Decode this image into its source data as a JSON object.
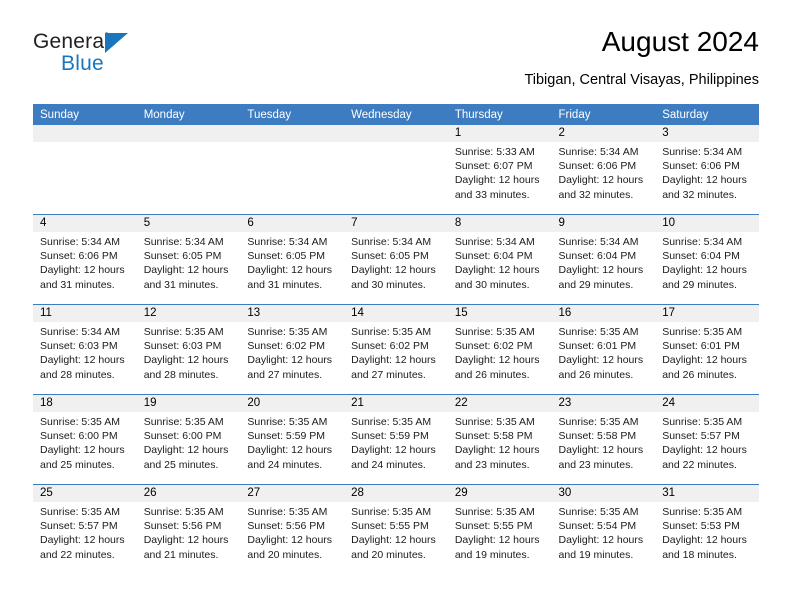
{
  "brand": {
    "name_top": "General",
    "name_bottom": "Blue",
    "triangle_color": "#1a76bc"
  },
  "header": {
    "title": "August 2024",
    "subtitle": "Tibigan, Central Visayas, Philippines",
    "accent_color": "#3d7cc0",
    "daynum_bg": "#f0f0f0"
  },
  "calendar": {
    "weekday_headers": [
      "Sunday",
      "Monday",
      "Tuesday",
      "Wednesday",
      "Thursday",
      "Friday",
      "Saturday"
    ],
    "labels": {
      "sunrise_prefix": "Sunrise:",
      "sunset_prefix": "Sunset:",
      "daylight_prefix": "Daylight:"
    },
    "weeks": [
      [
        {
          "day": "",
          "empty": true
        },
        {
          "day": "",
          "empty": true
        },
        {
          "day": "",
          "empty": true
        },
        {
          "day": "",
          "empty": true
        },
        {
          "day": "1",
          "sunrise": "Sunrise: 5:33 AM",
          "sunset": "Sunset: 6:07 PM",
          "daylight_line1": "Daylight: 12 hours",
          "daylight_line2": "and 33 minutes."
        },
        {
          "day": "2",
          "sunrise": "Sunrise: 5:34 AM",
          "sunset": "Sunset: 6:06 PM",
          "daylight_line1": "Daylight: 12 hours",
          "daylight_line2": "and 32 minutes."
        },
        {
          "day": "3",
          "sunrise": "Sunrise: 5:34 AM",
          "sunset": "Sunset: 6:06 PM",
          "daylight_line1": "Daylight: 12 hours",
          "daylight_line2": "and 32 minutes."
        }
      ],
      [
        {
          "day": "4",
          "sunrise": "Sunrise: 5:34 AM",
          "sunset": "Sunset: 6:06 PM",
          "daylight_line1": "Daylight: 12 hours",
          "daylight_line2": "and 31 minutes."
        },
        {
          "day": "5",
          "sunrise": "Sunrise: 5:34 AM",
          "sunset": "Sunset: 6:05 PM",
          "daylight_line1": "Daylight: 12 hours",
          "daylight_line2": "and 31 minutes."
        },
        {
          "day": "6",
          "sunrise": "Sunrise: 5:34 AM",
          "sunset": "Sunset: 6:05 PM",
          "daylight_line1": "Daylight: 12 hours",
          "daylight_line2": "and 31 minutes."
        },
        {
          "day": "7",
          "sunrise": "Sunrise: 5:34 AM",
          "sunset": "Sunset: 6:05 PM",
          "daylight_line1": "Daylight: 12 hours",
          "daylight_line2": "and 30 minutes."
        },
        {
          "day": "8",
          "sunrise": "Sunrise: 5:34 AM",
          "sunset": "Sunset: 6:04 PM",
          "daylight_line1": "Daylight: 12 hours",
          "daylight_line2": "and 30 minutes."
        },
        {
          "day": "9",
          "sunrise": "Sunrise: 5:34 AM",
          "sunset": "Sunset: 6:04 PM",
          "daylight_line1": "Daylight: 12 hours",
          "daylight_line2": "and 29 minutes."
        },
        {
          "day": "10",
          "sunrise": "Sunrise: 5:34 AM",
          "sunset": "Sunset: 6:04 PM",
          "daylight_line1": "Daylight: 12 hours",
          "daylight_line2": "and 29 minutes."
        }
      ],
      [
        {
          "day": "11",
          "sunrise": "Sunrise: 5:34 AM",
          "sunset": "Sunset: 6:03 PM",
          "daylight_line1": "Daylight: 12 hours",
          "daylight_line2": "and 28 minutes."
        },
        {
          "day": "12",
          "sunrise": "Sunrise: 5:35 AM",
          "sunset": "Sunset: 6:03 PM",
          "daylight_line1": "Daylight: 12 hours",
          "daylight_line2": "and 28 minutes."
        },
        {
          "day": "13",
          "sunrise": "Sunrise: 5:35 AM",
          "sunset": "Sunset: 6:02 PM",
          "daylight_line1": "Daylight: 12 hours",
          "daylight_line2": "and 27 minutes."
        },
        {
          "day": "14",
          "sunrise": "Sunrise: 5:35 AM",
          "sunset": "Sunset: 6:02 PM",
          "daylight_line1": "Daylight: 12 hours",
          "daylight_line2": "and 27 minutes."
        },
        {
          "day": "15",
          "sunrise": "Sunrise: 5:35 AM",
          "sunset": "Sunset: 6:02 PM",
          "daylight_line1": "Daylight: 12 hours",
          "daylight_line2": "and 26 minutes."
        },
        {
          "day": "16",
          "sunrise": "Sunrise: 5:35 AM",
          "sunset": "Sunset: 6:01 PM",
          "daylight_line1": "Daylight: 12 hours",
          "daylight_line2": "and 26 minutes."
        },
        {
          "day": "17",
          "sunrise": "Sunrise: 5:35 AM",
          "sunset": "Sunset: 6:01 PM",
          "daylight_line1": "Daylight: 12 hours",
          "daylight_line2": "and 26 minutes."
        }
      ],
      [
        {
          "day": "18",
          "sunrise": "Sunrise: 5:35 AM",
          "sunset": "Sunset: 6:00 PM",
          "daylight_line1": "Daylight: 12 hours",
          "daylight_line2": "and 25 minutes."
        },
        {
          "day": "19",
          "sunrise": "Sunrise: 5:35 AM",
          "sunset": "Sunset: 6:00 PM",
          "daylight_line1": "Daylight: 12 hours",
          "daylight_line2": "and 25 minutes."
        },
        {
          "day": "20",
          "sunrise": "Sunrise: 5:35 AM",
          "sunset": "Sunset: 5:59 PM",
          "daylight_line1": "Daylight: 12 hours",
          "daylight_line2": "and 24 minutes."
        },
        {
          "day": "21",
          "sunrise": "Sunrise: 5:35 AM",
          "sunset": "Sunset: 5:59 PM",
          "daylight_line1": "Daylight: 12 hours",
          "daylight_line2": "and 24 minutes."
        },
        {
          "day": "22",
          "sunrise": "Sunrise: 5:35 AM",
          "sunset": "Sunset: 5:58 PM",
          "daylight_line1": "Daylight: 12 hours",
          "daylight_line2": "and 23 minutes."
        },
        {
          "day": "23",
          "sunrise": "Sunrise: 5:35 AM",
          "sunset": "Sunset: 5:58 PM",
          "daylight_line1": "Daylight: 12 hours",
          "daylight_line2": "and 23 minutes."
        },
        {
          "day": "24",
          "sunrise": "Sunrise: 5:35 AM",
          "sunset": "Sunset: 5:57 PM",
          "daylight_line1": "Daylight: 12 hours",
          "daylight_line2": "and 22 minutes."
        }
      ],
      [
        {
          "day": "25",
          "sunrise": "Sunrise: 5:35 AM",
          "sunset": "Sunset: 5:57 PM",
          "daylight_line1": "Daylight: 12 hours",
          "daylight_line2": "and 22 minutes."
        },
        {
          "day": "26",
          "sunrise": "Sunrise: 5:35 AM",
          "sunset": "Sunset: 5:56 PM",
          "daylight_line1": "Daylight: 12 hours",
          "daylight_line2": "and 21 minutes."
        },
        {
          "day": "27",
          "sunrise": "Sunrise: 5:35 AM",
          "sunset": "Sunset: 5:56 PM",
          "daylight_line1": "Daylight: 12 hours",
          "daylight_line2": "and 20 minutes."
        },
        {
          "day": "28",
          "sunrise": "Sunrise: 5:35 AM",
          "sunset": "Sunset: 5:55 PM",
          "daylight_line1": "Daylight: 12 hours",
          "daylight_line2": "and 20 minutes."
        },
        {
          "day": "29",
          "sunrise": "Sunrise: 5:35 AM",
          "sunset": "Sunset: 5:55 PM",
          "daylight_line1": "Daylight: 12 hours",
          "daylight_line2": "and 19 minutes."
        },
        {
          "day": "30",
          "sunrise": "Sunrise: 5:35 AM",
          "sunset": "Sunset: 5:54 PM",
          "daylight_line1": "Daylight: 12 hours",
          "daylight_line2": "and 19 minutes."
        },
        {
          "day": "31",
          "sunrise": "Sunrise: 5:35 AM",
          "sunset": "Sunset: 5:53 PM",
          "daylight_line1": "Daylight: 12 hours",
          "daylight_line2": "and 18 minutes."
        }
      ]
    ]
  }
}
